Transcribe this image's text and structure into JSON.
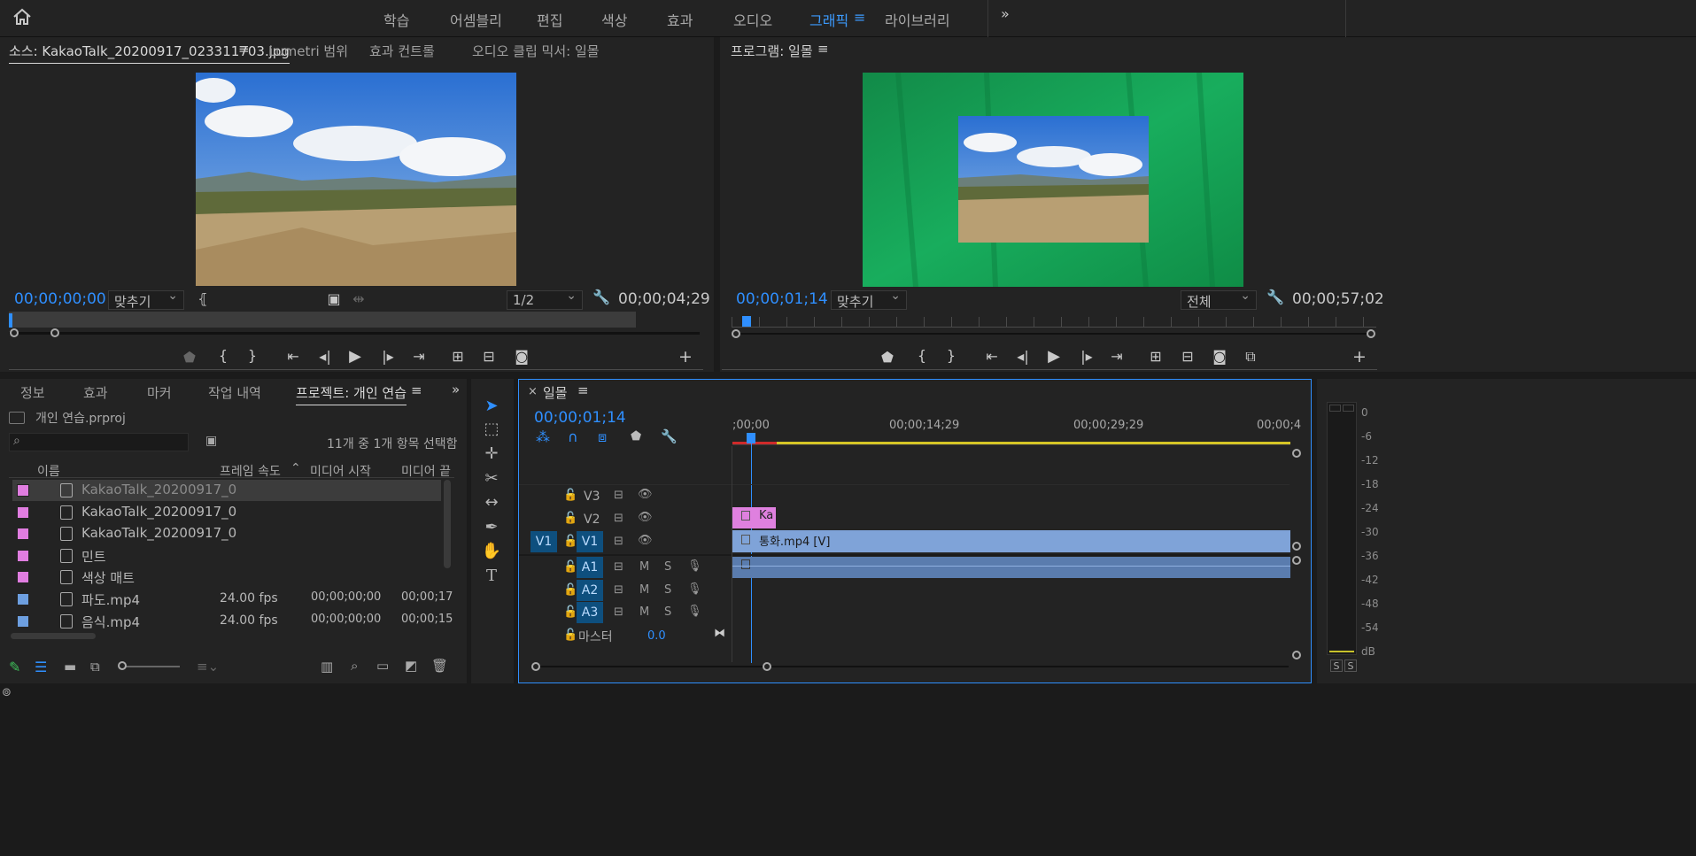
{
  "workspaces": [
    "학습",
    "어셈블리",
    "편집",
    "색상",
    "효과",
    "오디오",
    "그래픽",
    "라이브러리"
  ],
  "active_workspace": "그래픽",
  "source": {
    "tabs": [
      "소스: KakaoTalk_20200917_023311703.jpg",
      "Lumetri 범위",
      "효과 컨트롤",
      "오디오 클립 믹서: 일몰"
    ],
    "timecode": "00;00;00;00",
    "fit": "맞추기",
    "resolution": "1/2",
    "duration": "00;00;04;29"
  },
  "program": {
    "title": "프로그램: 일몰",
    "timecode": "00;00;01;14",
    "fit": "맞추기",
    "resolution": "전체",
    "duration": "00;00;57;02"
  },
  "project": {
    "tabs": [
      "정보",
      "효과",
      "마커",
      "작업 내역",
      "프로젝트: 개인 연습"
    ],
    "file": "개인 연습.prproj",
    "selection": "11개 중 1개 항목 선택함",
    "columns": [
      "이름",
      "프레임 속도",
      "미디어 시작",
      "미디어 끝"
    ],
    "items": [
      {
        "name": "KakaoTalk_20200917_0",
        "fps": "",
        "start": "",
        "end": "",
        "color": "#e07de0"
      },
      {
        "name": "KakaoTalk_20200917_0",
        "fps": "",
        "start": "",
        "end": "",
        "color": "#e07de0"
      },
      {
        "name": "KakaoTalk_20200917_0",
        "fps": "",
        "start": "",
        "end": "",
        "color": "#e07de0"
      },
      {
        "name": "민트",
        "fps": "",
        "start": "",
        "end": "",
        "color": "#e07de0"
      },
      {
        "name": "색상 매트",
        "fps": "",
        "start": "",
        "end": "",
        "color": "#e07de0"
      },
      {
        "name": "파도.mp4",
        "fps": "24.00 fps",
        "start": "00;00;00;00",
        "end": "00;00;17",
        "color": "#6d9fe0"
      },
      {
        "name": "음식.mp4",
        "fps": "24.00 fps",
        "start": "00;00;00;00",
        "end": "00;00;15",
        "color": "#6d9fe0"
      }
    ]
  },
  "timeline": {
    "title": "일몰",
    "timecode": "00;00;01;14",
    "ruler": [
      ";00;00",
      "00;00;14;29",
      "00;00;29;29",
      "00;00;4"
    ],
    "video_tracks": [
      "V3",
      "V2",
      "V1"
    ],
    "audio_tracks": [
      "A1",
      "A2",
      "A3"
    ],
    "source_patch_video": "V1",
    "master_label": "마스터",
    "master_value": "0.0",
    "clip_v2": "Ka",
    "clip_v1": "통화.mp4 [V]",
    "m": "M",
    "s": "S"
  },
  "meter": {
    "scale": [
      "0",
      "-6",
      "-12",
      "-18",
      "-24",
      "-30",
      "-36",
      "-42",
      "-48",
      "-54",
      "dB"
    ],
    "solo": [
      "S",
      "S"
    ]
  },
  "colors": {
    "accent": "#2f8fff",
    "green_screen": "#16a35a",
    "panel": "#232323"
  }
}
